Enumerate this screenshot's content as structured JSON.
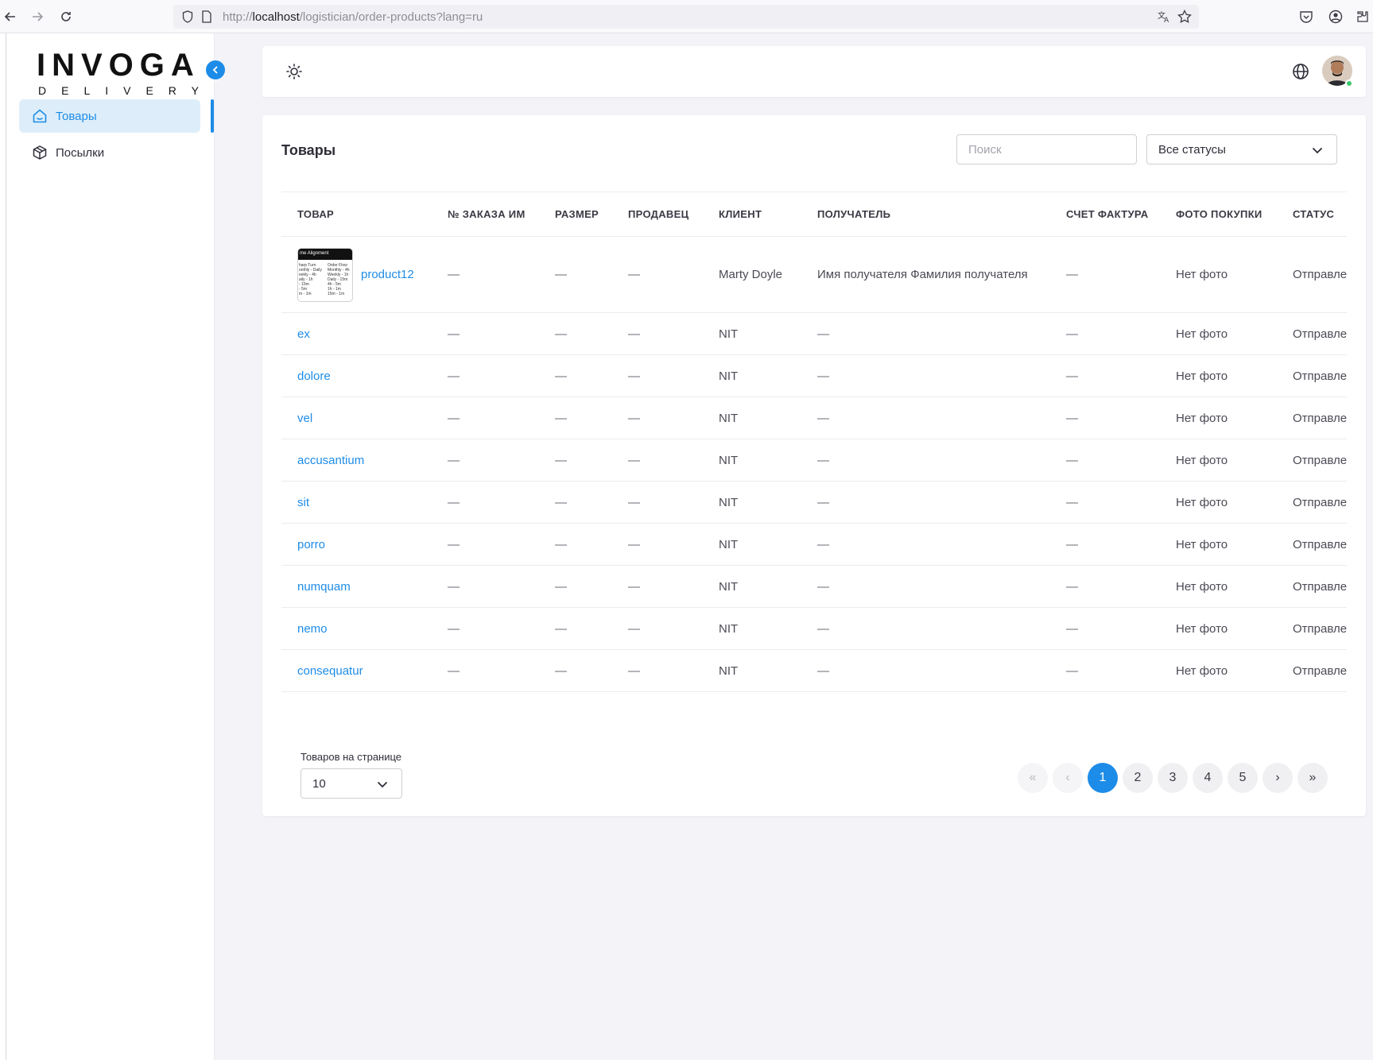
{
  "browser": {
    "url_prefix": "http://",
    "url_host": "localhost",
    "url_path": "/logistician/order-products?lang=ru"
  },
  "logo": {
    "main": "INVOGA",
    "sub": "DELIVERY"
  },
  "sidebar": {
    "items": [
      {
        "label": "Товары",
        "icon": "home-icon",
        "active": true
      },
      {
        "label": "Посылки",
        "icon": "package-icon",
        "active": false
      }
    ]
  },
  "page": {
    "title": "Товары",
    "search_placeholder": "Поиск",
    "status_filter": "Все статусы"
  },
  "table": {
    "columns": [
      "ТОВАР",
      "№ ЗАКАЗА ИМ",
      "РАЗМЕР",
      "ПРОДАВЕЦ",
      "КЛИЕНТ",
      "ПОЛУЧАТЕЛЬ",
      "СЧЕТ ФАКТУРА",
      "ФОТО ПОКУПКИ",
      "СТАТУС"
    ],
    "rows": [
      {
        "product": "product12",
        "order": "—",
        "size": "—",
        "seller": "—",
        "client": "Marty Doyle",
        "recipient": "Имя получателя Фамилия получателя",
        "invoice": "—",
        "photo": "Нет фото",
        "status": "Отправлено",
        "has_thumb": true
      },
      {
        "product": "ex",
        "order": "—",
        "size": "—",
        "seller": "—",
        "client": "NIT",
        "recipient": "—",
        "invoice": "—",
        "photo": "Нет фото",
        "status": "Отправлено"
      },
      {
        "product": "dolore",
        "order": "—",
        "size": "—",
        "seller": "—",
        "client": "NIT",
        "recipient": "—",
        "invoice": "—",
        "photo": "Нет фото",
        "status": "Отправлено"
      },
      {
        "product": "vel",
        "order": "—",
        "size": "—",
        "seller": "—",
        "client": "NIT",
        "recipient": "—",
        "invoice": "—",
        "photo": "Нет фото",
        "status": "Отправлено"
      },
      {
        "product": "accusantium",
        "order": "—",
        "size": "—",
        "seller": "—",
        "client": "NIT",
        "recipient": "—",
        "invoice": "—",
        "photo": "Нет фото",
        "status": "Отправлено"
      },
      {
        "product": "sit",
        "order": "—",
        "size": "—",
        "seller": "—",
        "client": "NIT",
        "recipient": "—",
        "invoice": "—",
        "photo": "Нет фото",
        "status": "Отправлено"
      },
      {
        "product": "porro",
        "order": "—",
        "size": "—",
        "seller": "—",
        "client": "NIT",
        "recipient": "—",
        "invoice": "—",
        "photo": "Нет фото",
        "status": "Отправлено"
      },
      {
        "product": "numquam",
        "order": "—",
        "size": "—",
        "seller": "—",
        "client": "NIT",
        "recipient": "—",
        "invoice": "—",
        "photo": "Нет фото",
        "status": "Отправлено"
      },
      {
        "product": "nemo",
        "order": "—",
        "size": "—",
        "seller": "—",
        "client": "NIT",
        "recipient": "—",
        "invoice": "—",
        "photo": "Нет фото",
        "status": "Отправлено"
      },
      {
        "product": "consequatur",
        "order": "—",
        "size": "—",
        "seller": "—",
        "client": "NIT",
        "recipient": "—",
        "invoice": "—",
        "photo": "Нет фото",
        "status": "Отправлено"
      }
    ]
  },
  "thumb": {
    "header": "me Alignment",
    "lines": [
      "harp Turn",
      "Order Flow",
      "onthly - Daily",
      "Monthly - 4h",
      "eekly - 4h",
      "Weekly - 1h",
      "aily - 1h",
      "Daily - 15m",
      "- 15m",
      "4h - 5m",
      "- 5m",
      "1h - 1m",
      "m - 1m",
      "15m - 1m"
    ]
  },
  "pagination": {
    "per_page_label": "Товаров на странице",
    "per_page_value": "10",
    "first": "«",
    "prev": "‹",
    "pages": [
      "1",
      "2",
      "3",
      "4",
      "5"
    ],
    "current": "1",
    "next": "›",
    "last": "»"
  },
  "colors": {
    "accent": "#1d8ce8",
    "online": "#3bc96b"
  }
}
